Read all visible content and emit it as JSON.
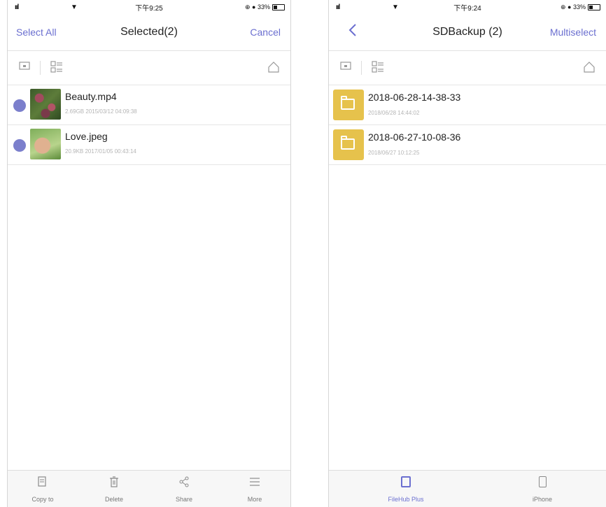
{
  "left": {
    "status": {
      "signal": "ııl",
      "time": "下午9:25",
      "right": "⊕ ● 33%"
    },
    "nav": {
      "left_label": "Select All",
      "title": "Selected(2)",
      "right_label": "Cancel"
    },
    "files": [
      {
        "name": "Beauty.mp4",
        "meta": "2.69GB 2015/03/12 04:09:38",
        "selected": true
      },
      {
        "name": "Love.jpeg",
        "meta": "20.9KB 2017/01/05 00:43:14",
        "selected": true
      }
    ],
    "actions": [
      {
        "label": "Copy to",
        "icon": "copy-icon"
      },
      {
        "label": "Delete",
        "icon": "trash-icon"
      },
      {
        "label": "Share",
        "icon": "share-icon"
      },
      {
        "label": "More",
        "icon": "menu-icon"
      }
    ]
  },
  "right": {
    "status": {
      "signal": "ııl",
      "time": "下午9:24",
      "right": "⊕ ● 33%"
    },
    "nav": {
      "title": "SDBackup (2)",
      "right_label": "Multiselect"
    },
    "folders": [
      {
        "name": "2018-06-28-14-38-33",
        "meta": "2018/06/28 14:44:02"
      },
      {
        "name": "2018-06-27-10-08-36",
        "meta": "2018/06/27 10:12:25"
      }
    ],
    "tabs": [
      {
        "label": "FileHub Plus",
        "icon": "tablet-icon",
        "active": true
      },
      {
        "label": "iPhone",
        "icon": "phone-icon",
        "active": false
      }
    ]
  },
  "colors": {
    "accent": "#6b6fd0",
    "folder": "#e6c24c",
    "selection_dot": "#7b7fcc"
  }
}
